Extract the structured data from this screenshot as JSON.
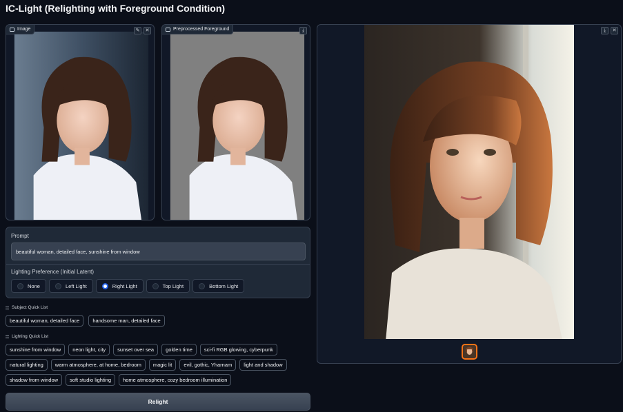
{
  "app": {
    "title": "IC-Light (Relighting with Foreground Condition)"
  },
  "image_panel": {
    "label": "Image",
    "icon": "image-icon",
    "edit_icon": "pencil-icon",
    "close_icon": "close-icon"
  },
  "preprocessed_panel": {
    "label": "Preprocessed Foreground",
    "icon": "image-icon",
    "download_icon": "download-icon"
  },
  "output_panel": {
    "download_icon": "download-icon",
    "close_icon": "close-icon"
  },
  "prompt": {
    "label": "Prompt",
    "value": "beautiful woman, detailed face, sunshine from window"
  },
  "lighting_preference": {
    "label": "Lighting Preference (Initial Latent)",
    "options": [
      "None",
      "Left Light",
      "Right Light",
      "Top Light",
      "Bottom Light"
    ],
    "selected": "Right Light"
  },
  "subject_quick_list": {
    "label": "Subject Quick List",
    "items": [
      "beautiful woman, detailed face",
      "handsome man, detailed face"
    ]
  },
  "lighting_quick_list": {
    "label": "Lighting Quick List",
    "rows": [
      [
        "sunshine from window",
        "neon light, city",
        "sunset over sea",
        "golden time",
        "sci-fi RGB glowing, cyberpunk"
      ],
      [
        "natural lighting",
        "warm atmosphere, at home, bedroom",
        "magic lit",
        "evil, gothic, Yharnam",
        "light and shadow"
      ],
      [
        "shadow from window",
        "soft studio lighting",
        "home atmosphere, cozy bedroom illumination"
      ]
    ]
  },
  "relight_button": {
    "label": "Relight"
  },
  "colors": {
    "background": "#0b0f19",
    "accent": "#2563eb",
    "thumb_border": "#f97316"
  }
}
